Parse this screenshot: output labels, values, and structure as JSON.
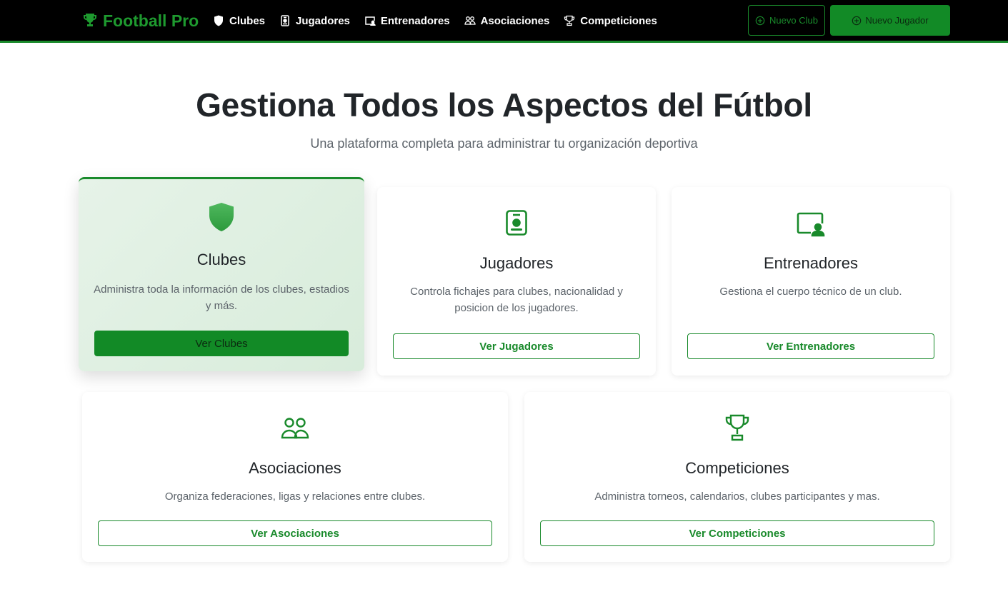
{
  "navbar": {
    "brand": "Football Pro",
    "links": [
      {
        "label": "Clubes",
        "icon": "shield-icon"
      },
      {
        "label": "Jugadores",
        "icon": "id-badge-icon"
      },
      {
        "label": "Entrenadores",
        "icon": "person-video-icon"
      },
      {
        "label": "Asociaciones",
        "icon": "people-icon"
      },
      {
        "label": "Competiciones",
        "icon": "trophy-icon"
      }
    ],
    "new_club": "Nuevo Club",
    "new_player": "Nuevo Jugador"
  },
  "hero": {
    "title": "Gestiona Todos los Aspectos del Fútbol",
    "subtitle": "Una plataforma completa para administrar tu organización deportiva"
  },
  "cards": [
    {
      "title": "Clubes",
      "text": "Administra toda la información de los clubes, estadios y más.",
      "button": "Ver Clubes",
      "icon": "shield-icon"
    },
    {
      "title": "Jugadores",
      "text": "Controla fichajes para clubes, nacionalidad y posicion de los jugadores.",
      "button": "Ver Jugadores",
      "icon": "id-badge-icon"
    },
    {
      "title": "Entrenadores",
      "text": "Gestiona el cuerpo técnico de un club.",
      "button": "Ver Entrenadores",
      "icon": "person-video-icon"
    },
    {
      "title": "Asociaciones",
      "text": "Organiza federaciones, ligas y relaciones entre clubes.",
      "button": "Ver Asociaciones",
      "icon": "people-icon"
    },
    {
      "title": "Competiciones",
      "text": "Administra torneos, calendarios, clubes participantes y mas.",
      "button": "Ver Competiciones",
      "icon": "trophy-icon"
    }
  ],
  "colors": {
    "accent": "#198a2b",
    "navbar_bg": "#000000",
    "active_card_bg": "#e0efe3"
  }
}
